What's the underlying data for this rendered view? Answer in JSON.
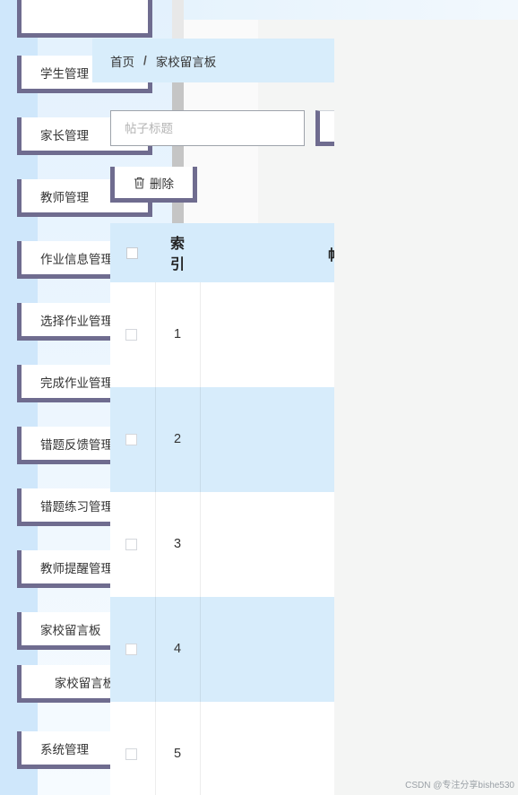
{
  "sidebar": {
    "items": [
      {
        "label": "",
        "stub": true
      },
      {
        "label": "学生管理"
      },
      {
        "label": "家长管理"
      },
      {
        "label": "教师管理"
      },
      {
        "label": "作业信息管理"
      },
      {
        "label": "选择作业管理"
      },
      {
        "label": "完成作业管理"
      },
      {
        "label": "错题反馈管理"
      },
      {
        "label": "错题练习管理"
      },
      {
        "label": "教师提醒管理"
      },
      {
        "label": "家校留言板"
      },
      {
        "label": "家校留言板",
        "sub": true
      },
      {
        "label": "系统管理"
      }
    ]
  },
  "breadcrumb": {
    "home": "首页",
    "separator": "/",
    "current": "家校留言板"
  },
  "search": {
    "placeholder": "帖子标题",
    "value": ""
  },
  "toolbar": {
    "delete_label": "删除"
  },
  "table": {
    "headers": {
      "index": "索引",
      "title": "帖"
    },
    "rows": [
      {
        "index": "1"
      },
      {
        "index": "2"
      },
      {
        "index": "3"
      },
      {
        "index": "4"
      },
      {
        "index": "5"
      }
    ]
  },
  "watermark": "CSDN @专注分享bishe530",
  "colors": {
    "accent_border": "#6f6c8f",
    "header_blue": "#d5ebfb",
    "row_blue": "#d7ecfb",
    "sidebar_strip": "#cfe7fb"
  },
  "icons": {
    "chevron": "chevron-down-icon",
    "delete": "trash-icon"
  }
}
